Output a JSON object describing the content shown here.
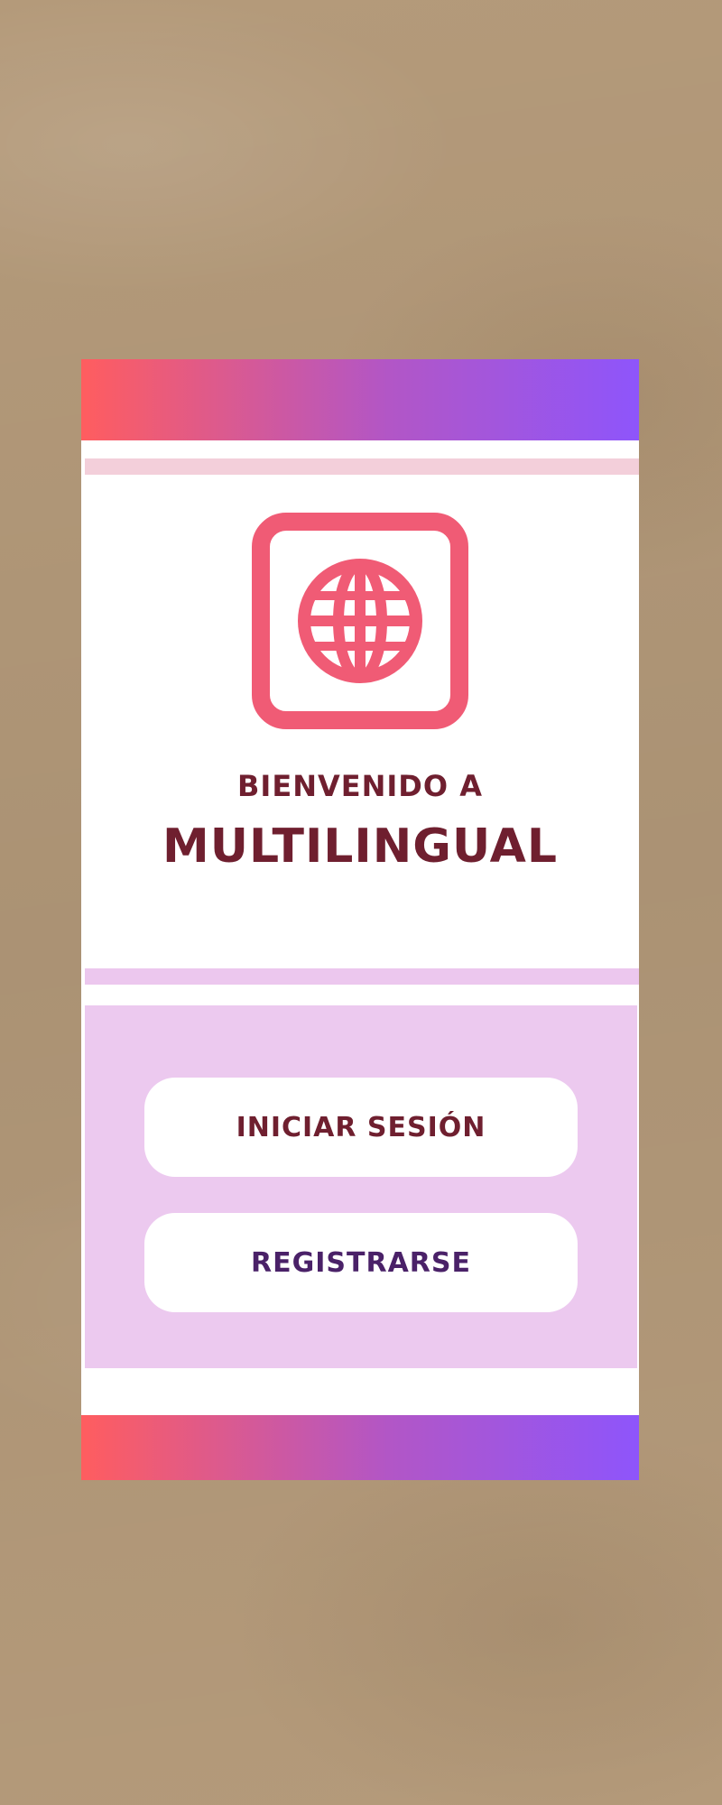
{
  "welcome": {
    "line1": "Bienvenido a",
    "line2": "Multilingual"
  },
  "buttons": {
    "login_label": "INICIAR SESIÓN",
    "register_label": "REGISTRARSE"
  },
  "icons": {
    "app_icon": "globe-icon"
  },
  "colors": {
    "gradient_start": "#ff5d5f",
    "gradient_end": "#8e55fb",
    "icon_pink": "#f05b75",
    "title_maroon": "#6f1f2f",
    "register_purple": "#4a2168",
    "panel_lilac": "#ecc9ef"
  }
}
